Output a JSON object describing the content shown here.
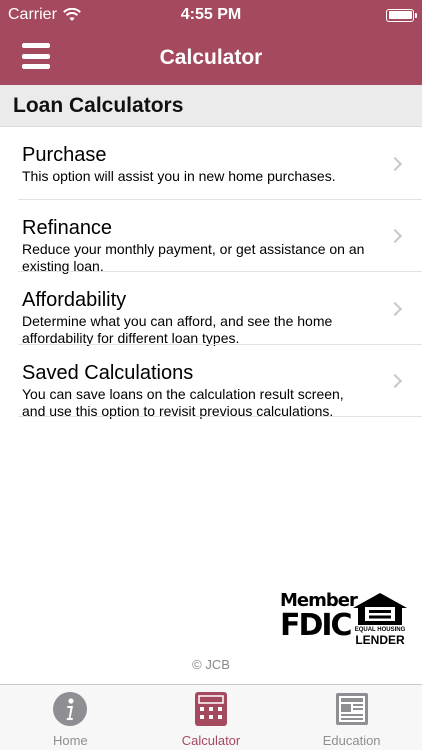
{
  "status_bar": {
    "carrier": "Carrier",
    "time": "4:55 PM"
  },
  "nav_bar": {
    "title": "Calculator"
  },
  "section": {
    "header": "Loan Calculators"
  },
  "list_items": [
    {
      "title": "Purchase",
      "description": "This option will assist you in new home purchases."
    },
    {
      "title": "Refinance",
      "description": "Reduce your monthly payment, or get assistance on an existing loan."
    },
    {
      "title": "Affordability",
      "description": "Determine what you can afford, and see the home affordability for different loan types."
    },
    {
      "title": "Saved Calculations",
      "description": "You can save loans on the calculation result screen, and use this option to revisit previous calculations."
    }
  ],
  "logos": {
    "fdic_top": "Member",
    "fdic_bottom": "FDIC",
    "ehl_small": "EQUAL HOUSING",
    "ehl_lender": "LENDER"
  },
  "footer": {
    "copyright": "© JCB"
  },
  "tabs": [
    {
      "label": "Home",
      "icon": "info-icon",
      "active": false
    },
    {
      "label": "Calculator",
      "icon": "calculator-icon",
      "active": true
    },
    {
      "label": "Education",
      "icon": "newspaper-icon",
      "active": false
    }
  ],
  "colors": {
    "brand": "#a54a5e",
    "tab_inactive": "#8e8e93",
    "chevron": "#c7c7cc"
  }
}
